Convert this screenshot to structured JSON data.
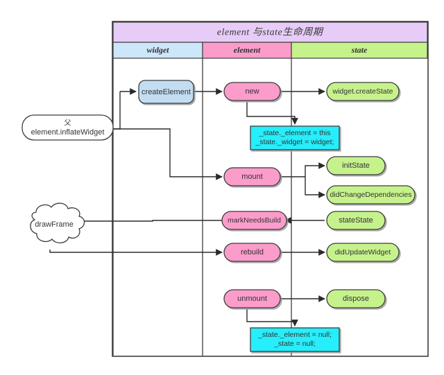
{
  "diagram": {
    "title": "element 与state生命周期",
    "columns": [
      {
        "key": "widget",
        "label": "widget",
        "color": "#cce6fa"
      },
      {
        "key": "element",
        "label": "element",
        "color": "#fb9ccb"
      },
      {
        "key": "state",
        "label": "state",
        "color": "#c6f28c"
      }
    ],
    "header_color": "#e6ccf7",
    "external": {
      "inflate_line1": "父",
      "inflate_line2": "element.inflateWidget",
      "draw_frame": "drawFrame"
    },
    "widget_nodes": [
      {
        "name": "create-element",
        "label": "createElement",
        "color": "#c2ddf2"
      }
    ],
    "element_nodes": [
      {
        "name": "new",
        "label": "new",
        "color": "#fb9ccb"
      },
      {
        "name": "mount",
        "label": "mount",
        "color": "#fb9ccb"
      },
      {
        "name": "mark-needs-build",
        "label": "markNeedsBuild",
        "color": "#fb9ccb"
      },
      {
        "name": "rebuild",
        "label": "rebuild",
        "color": "#fb9ccb"
      },
      {
        "name": "unmount",
        "label": "unmount",
        "color": "#fb9ccb"
      }
    ],
    "state_nodes": [
      {
        "name": "widget-create-state",
        "label": "widget.createState",
        "color": "#c6f28c"
      },
      {
        "name": "init-state",
        "label": "initState",
        "color": "#c6f28c"
      },
      {
        "name": "did-change-dependencies",
        "label": "didChangeDependencies",
        "color": "#c6f28c"
      },
      {
        "name": "state-state",
        "label": "stateState",
        "color": "#c6f28c"
      },
      {
        "name": "did-update-widget",
        "label": "didUpdateWidget",
        "color": "#c6f28c"
      },
      {
        "name": "dispose",
        "label": "dispose",
        "color": "#c6f28c"
      }
    ],
    "assignment_boxes": [
      {
        "name": "assign-state-init",
        "line1": "_state._element = this",
        "line2": "_state._widget = widget;",
        "color": "#28eefa"
      },
      {
        "name": "assign-state-null",
        "line1": "_state._element = null;",
        "line2": "_state = null;",
        "color": "#28eefa"
      }
    ]
  }
}
